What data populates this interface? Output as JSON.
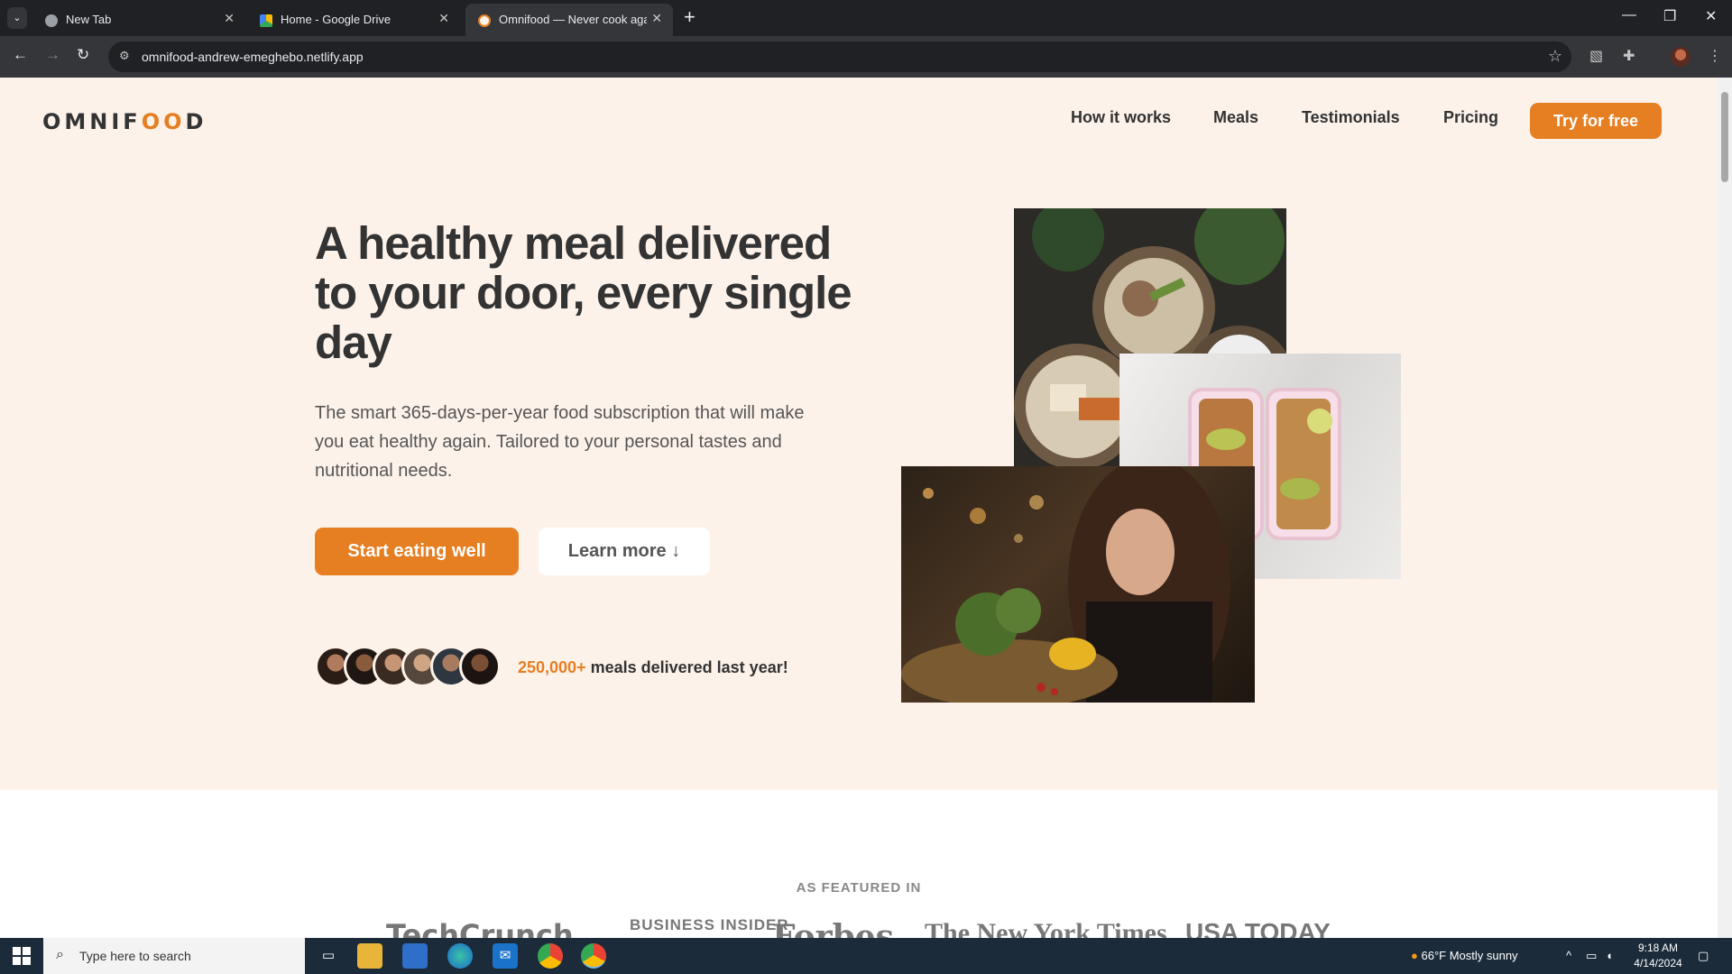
{
  "browser": {
    "tabs": [
      {
        "title": "New Tab",
        "active": false
      },
      {
        "title": "Home - Google Drive",
        "active": false
      },
      {
        "title": "Omnifood — Never cook again!",
        "active": true
      }
    ],
    "url": "omnifood-andrew-emeghebo.netlify.app"
  },
  "site": {
    "logo_text_1": "OMNIF",
    "logo_text_2": "OO",
    "logo_text_3": "D",
    "nav": [
      "How it works",
      "Meals",
      "Testimonials",
      "Pricing"
    ],
    "nav_cta": "Try for free",
    "hero": {
      "title": "A healthy meal delivered to your door, every single day",
      "description": "The smart 365-days-per-year food subscription that will make you eat healthy again. Tailored to your personal tastes and nutritional needs.",
      "primary_button": "Start eating well",
      "secondary_button": "Learn more ↓",
      "delivered_count": "250,000+",
      "delivered_text": " meals delivered last year!"
    },
    "featured": {
      "label": "AS FEATURED IN",
      "logos": [
        "TechCrunch",
        "BUSINESS INSIDER",
        "Forbes",
        "The New York Times",
        "USA TODAY"
      ]
    }
  },
  "taskbar": {
    "search_placeholder": "Type here to search",
    "weather": "66°F  Mostly sunny",
    "time": "9:18 AM",
    "date": "4/14/2024"
  },
  "colors": {
    "accent": "#e67e22",
    "hero_bg": "#fdf2e9"
  }
}
